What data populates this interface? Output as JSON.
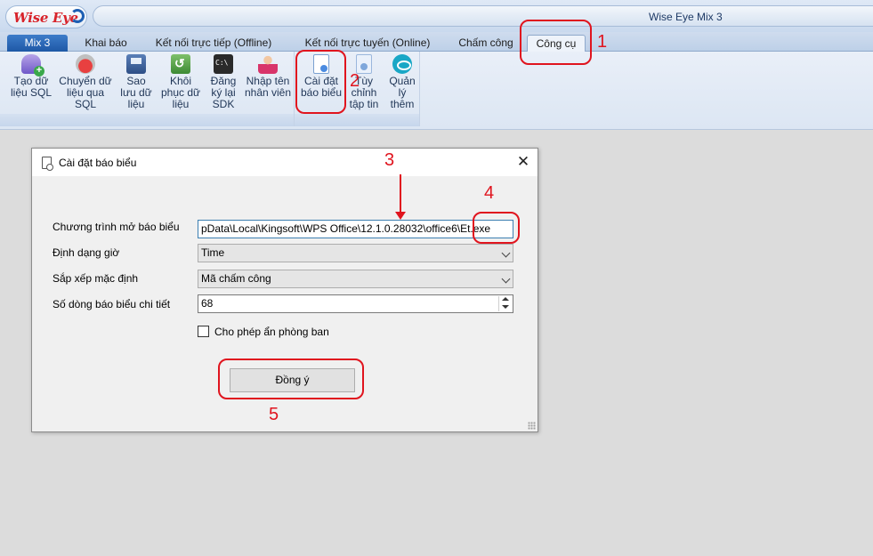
{
  "app": {
    "logo_text": "Wise Eye",
    "title": "Wise Eye Mix 3"
  },
  "tabs": [
    {
      "label": "Mix 3"
    },
    {
      "label": "Khai báo"
    },
    {
      "label": "Kết nối trực tiếp (Offline)"
    },
    {
      "label": "Kết nối trực tuyến (Online)"
    },
    {
      "label": "Chấm công"
    },
    {
      "label": "Công cụ"
    }
  ],
  "ribbon": {
    "buttons": [
      {
        "label": "Tạo dữ liệu SQL",
        "icon": "database-add-icon"
      },
      {
        "label": "Chuyển dữ liệu qua SQL",
        "icon": "transfer-icon"
      },
      {
        "label": "Sao lưu dữ liệu",
        "icon": "backup-icon"
      },
      {
        "label": "Khôi phục dữ liệu",
        "icon": "restore-icon"
      },
      {
        "label": "Đăng ký lại SDK",
        "icon": "console-icon"
      },
      {
        "label": "Nhập tên nhân viên",
        "icon": "employee-icon"
      },
      {
        "label": "Cài đặt báo biểu",
        "icon": "report-settings-icon"
      },
      {
        "label": "Tùy chỉnh tập tin",
        "icon": "file-settings-icon"
      },
      {
        "label": "Quản lý thêm",
        "icon": "eye-icon"
      }
    ]
  },
  "dialog": {
    "title": "Cài đặt báo biểu",
    "close_symbol": "✕",
    "fields": {
      "program_label": "Chương trình mở báo biểu",
      "program_value": "pData\\Local\\Kingsoft\\WPS Office\\12.1.0.28032\\office6\\Et.exe",
      "time_format_label": "Định dạng giờ",
      "time_format_value": "Time",
      "sort_label": "Sắp xếp mặc định",
      "sort_value": "Mã chấm công",
      "rows_label": "Số dòng báo biểu chi tiết",
      "rows_value": "68"
    },
    "checkbox_label": "Cho phép ẩn phòng ban",
    "checkbox_checked": false,
    "ok_label": "Đồng ý"
  },
  "annotations": {
    "numbers": [
      "1",
      "2",
      "3",
      "4",
      "5"
    ],
    "color": "#e0141e"
  }
}
